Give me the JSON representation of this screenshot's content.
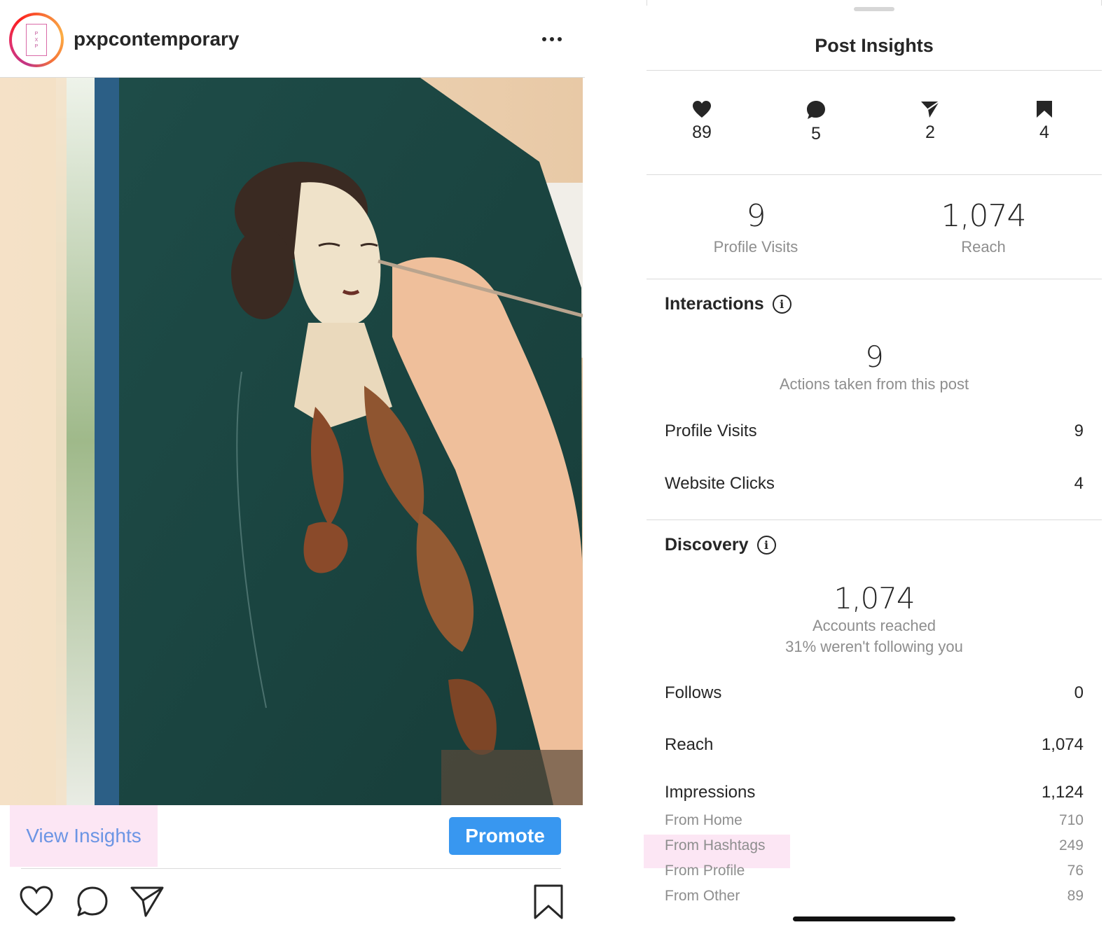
{
  "post": {
    "username": "pxpcontemporary",
    "avatar_letters": [
      "P",
      "X",
      "P"
    ],
    "more_icon": "more-horizontal-icon",
    "view_insights_label": "View Insights",
    "promote_label": "Promote",
    "actions": [
      "heart-icon",
      "comment-icon",
      "share-icon",
      "bookmark-icon"
    ]
  },
  "insights": {
    "title": "Post Insights",
    "engagement": [
      {
        "icon": "heart-icon",
        "value": "89"
      },
      {
        "icon": "comment-icon",
        "value": "5"
      },
      {
        "icon": "share-icon",
        "value": "2"
      },
      {
        "icon": "bookmark-icon",
        "value": "4"
      }
    ],
    "summary": [
      {
        "value": "9",
        "label": "Profile Visits"
      },
      {
        "value": "1,074",
        "label": "Reach"
      }
    ],
    "interactions": {
      "title": "Interactions",
      "total": "9",
      "caption": "Actions taken from this post",
      "rows": [
        {
          "label": "Profile Visits",
          "value": "9"
        },
        {
          "label": "Website Clicks",
          "value": "4"
        }
      ]
    },
    "discovery": {
      "title": "Discovery",
      "total": "1,074",
      "caption": "Accounts reached",
      "subcaption": "31% weren't following you",
      "rows": [
        {
          "label": "Follows",
          "value": "0"
        },
        {
          "label": "Reach",
          "value": "1,074"
        },
        {
          "label": "Impressions",
          "value": "1,124"
        }
      ],
      "impression_sources": [
        {
          "label": "From Home",
          "value": "710"
        },
        {
          "label": "From Hashtags",
          "value": "249"
        },
        {
          "label": "From Profile",
          "value": "76"
        },
        {
          "label": "From Other",
          "value": "89"
        }
      ]
    }
  },
  "colors": {
    "accent_blue": "#3897f0",
    "link_blue": "#6c95e4",
    "highlight_pink": "#fce6f4",
    "secondary_text": "#8e8e8e"
  }
}
